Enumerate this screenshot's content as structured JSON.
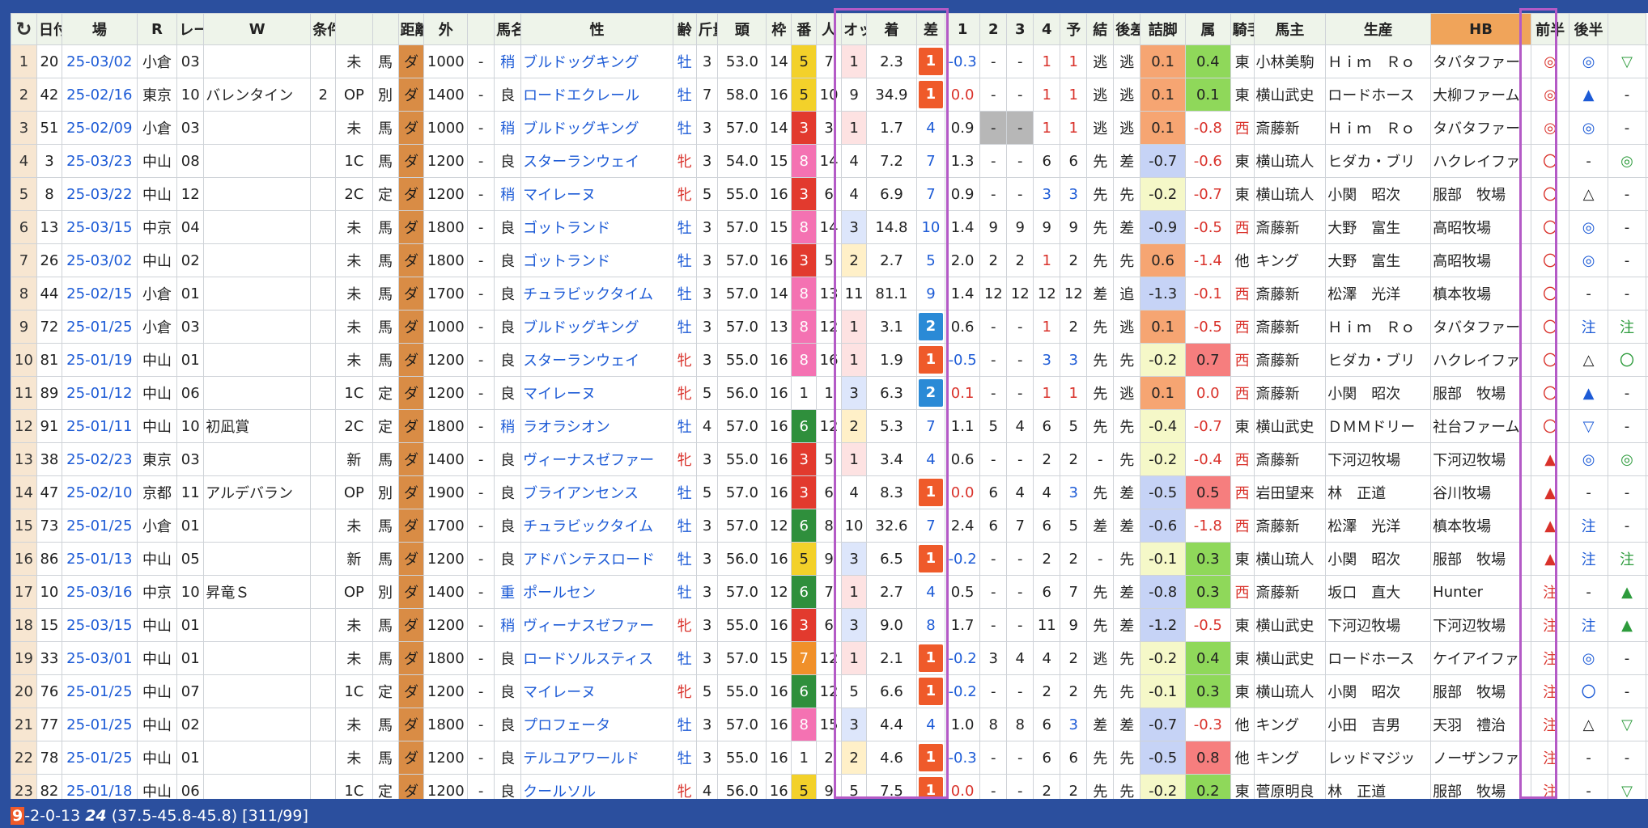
{
  "headers": [
    "↻",
    "日付",
    "場",
    "R",
    "レース名",
    "W",
    "条件",
    "",
    "",
    "距離",
    "外",
    "",
    "馬名",
    "性",
    "齢",
    "斤量",
    "頭",
    "枠",
    "番",
    "人",
    "オッズ",
    "着",
    "差",
    "1",
    "2",
    "3",
    "4",
    "予",
    "結",
    "後差",
    "詰脚",
    "属",
    "騎手",
    "馬主",
    "生産",
    "HB",
    "前半",
    "後半",
    ""
  ],
  "rows": [
    [
      "1",
      "20",
      "25-03/02",
      "小倉",
      "03",
      "",
      "",
      "未",
      "馬",
      "ダ",
      "1000",
      "-",
      "稍",
      "ブルドッグキング",
      "牡",
      "3",
      "53.0",
      "14",
      "5",
      "7",
      "1",
      "2.3",
      "1",
      "-0.3",
      "-",
      "-",
      "1",
      "1",
      "逃",
      "逃",
      "0.1",
      "0.4",
      "東",
      "小林美駒",
      "Ｈｉｍ　Ｒｏ",
      "タバタファー",
      "◎",
      "◎",
      "▽"
    ],
    [
      "2",
      "42",
      "25-02/16",
      "東京",
      "10",
      "バレンタイン",
      "2",
      "OP",
      "別",
      "ダ",
      "1400",
      "-",
      "良",
      "ロードエクレール",
      "牡",
      "7",
      "58.0",
      "16",
      "5",
      "10",
      "9",
      "34.9",
      "1",
      "0.0",
      "-",
      "-",
      "1",
      "1",
      "逃",
      "逃",
      "0.1",
      "0.1",
      "東",
      "横山武史",
      "ロードホース",
      "大柳ファーム",
      "◎",
      "▲",
      "-"
    ],
    [
      "3",
      "51",
      "25-02/09",
      "小倉",
      "03",
      "",
      "",
      "未",
      "馬",
      "ダ",
      "1000",
      "-",
      "稍",
      "ブルドッグキング",
      "牡",
      "3",
      "57.0",
      "14",
      "3",
      "3",
      "1",
      "1.7",
      "4",
      "0.9",
      "-",
      "-",
      "1",
      "1",
      "逃",
      "逃",
      "0.1",
      "-0.8",
      "西",
      "斎藤新",
      "Ｈｉｍ　Ｒｏ",
      "タバタファー",
      "◎",
      "◎",
      "-"
    ],
    [
      "4",
      "3",
      "25-03/23",
      "中山",
      "08",
      "",
      "",
      "1C",
      "馬",
      "ダ",
      "1200",
      "-",
      "良",
      "スターランウェイ",
      "牝",
      "3",
      "54.0",
      "15",
      "8",
      "14",
      "4",
      "7.2",
      "7",
      "1.3",
      "-",
      "-",
      "6",
      "6",
      "先",
      "差",
      "-0.7",
      "-0.6",
      "東",
      "横山琉人",
      "ヒダカ・ブリ",
      "ハクレイファ",
      "〇",
      "-",
      "◎"
    ],
    [
      "5",
      "8",
      "25-03/22",
      "中山",
      "12",
      "",
      "",
      "2C",
      "定",
      "ダ",
      "1200",
      "-",
      "稍",
      "マイレーヌ",
      "牝",
      "5",
      "55.0",
      "16",
      "3",
      "6",
      "4",
      "6.9",
      "7",
      "0.9",
      "-",
      "-",
      "3",
      "3",
      "先",
      "先",
      "-0.2",
      "-0.7",
      "東",
      "横山琉人",
      "小関　昭次",
      "服部　牧場",
      "〇",
      "△",
      "-"
    ],
    [
      "6",
      "13",
      "25-03/15",
      "中京",
      "04",
      "",
      "",
      "未",
      "馬",
      "ダ",
      "1800",
      "-",
      "良",
      "ゴットランド",
      "牡",
      "3",
      "57.0",
      "15",
      "8",
      "14",
      "3",
      "14.8",
      "10",
      "1.4",
      "9",
      "9",
      "9",
      "9",
      "先",
      "差",
      "-0.9",
      "-0.5",
      "西",
      "斎藤新",
      "大野　富生",
      "高昭牧場",
      "〇",
      "◎",
      "-"
    ],
    [
      "7",
      "26",
      "25-03/02",
      "中山",
      "02",
      "",
      "",
      "未",
      "馬",
      "ダ",
      "1800",
      "-",
      "良",
      "ゴットランド",
      "牡",
      "3",
      "57.0",
      "16",
      "3",
      "5",
      "2",
      "2.7",
      "5",
      "2.0",
      "2",
      "2",
      "1",
      "2",
      "先",
      "先",
      "0.6",
      "-1.4",
      "他",
      "キング",
      "大野　富生",
      "高昭牧場",
      "〇",
      "◎",
      "-"
    ],
    [
      "8",
      "44",
      "25-02/15",
      "小倉",
      "01",
      "",
      "",
      "未",
      "馬",
      "ダ",
      "1700",
      "-",
      "良",
      "チュラビックタイム",
      "牡",
      "3",
      "57.0",
      "14",
      "8",
      "13",
      "11",
      "81.1",
      "9",
      "1.4",
      "12",
      "12",
      "12",
      "12",
      "差",
      "追",
      "-1.3",
      "-0.1",
      "西",
      "斎藤新",
      "松澤　光洋",
      "槙本牧場",
      "〇",
      "-",
      "-"
    ],
    [
      "9",
      "72",
      "25-01/25",
      "小倉",
      "03",
      "",
      "",
      "未",
      "馬",
      "ダ",
      "1000",
      "-",
      "良",
      "ブルドッグキング",
      "牡",
      "3",
      "57.0",
      "13",
      "8",
      "12",
      "1",
      "3.1",
      "2",
      "0.6",
      "-",
      "-",
      "1",
      "2",
      "先",
      "逃",
      "0.1",
      "-0.5",
      "西",
      "斎藤新",
      "Ｈｉｍ　Ｒｏ",
      "タバタファー",
      "〇",
      "注",
      "注"
    ],
    [
      "10",
      "81",
      "25-01/19",
      "中山",
      "01",
      "",
      "",
      "未",
      "馬",
      "ダ",
      "1200",
      "-",
      "良",
      "スターランウェイ",
      "牝",
      "3",
      "55.0",
      "16",
      "8",
      "16",
      "1",
      "1.9",
      "1",
      "-0.5",
      "-",
      "-",
      "3",
      "3",
      "先",
      "先",
      "-0.2",
      "0.7",
      "西",
      "斎藤新",
      "ヒダカ・ブリ",
      "ハクレイファ",
      "〇",
      "△",
      "〇"
    ],
    [
      "11",
      "89",
      "25-01/12",
      "中山",
      "06",
      "",
      "",
      "1C",
      "定",
      "ダ",
      "1200",
      "-",
      "良",
      "マイレーヌ",
      "牝",
      "5",
      "56.0",
      "16",
      "1",
      "1",
      "3",
      "6.3",
      "2",
      "0.1",
      "-",
      "-",
      "1",
      "1",
      "先",
      "逃",
      "0.1",
      "0.0",
      "西",
      "斎藤新",
      "小関　昭次",
      "服部　牧場",
      "〇",
      "▲",
      "-"
    ],
    [
      "12",
      "91",
      "25-01/11",
      "中山",
      "10",
      "初凪賞",
      "",
      "2C",
      "定",
      "ダ",
      "1800",
      "-",
      "稍",
      "ラオラシオン",
      "牡",
      "4",
      "57.0",
      "16",
      "6",
      "12",
      "2",
      "5.3",
      "7",
      "1.1",
      "5",
      "4",
      "6",
      "5",
      "先",
      "先",
      "-0.4",
      "-0.7",
      "東",
      "横山武史",
      "ＤＭＭドリー",
      "社台ファーム",
      "〇",
      "▽",
      "-"
    ],
    [
      "13",
      "38",
      "25-02/23",
      "東京",
      "03",
      "",
      "",
      "新",
      "馬",
      "ダ",
      "1400",
      "-",
      "良",
      "ヴィーナスゼファー",
      "牝",
      "3",
      "55.0",
      "16",
      "3",
      "5",
      "1",
      "3.4",
      "4",
      "0.6",
      "-",
      "-",
      "2",
      "2",
      "-",
      "先",
      "-0.2",
      "-0.4",
      "西",
      "斎藤新",
      "下河辺牧場",
      "下河辺牧場",
      "▲",
      "◎",
      "◎"
    ],
    [
      "14",
      "47",
      "25-02/10",
      "京都",
      "11",
      "アルデバラン",
      "",
      "OP",
      "別",
      "ダ",
      "1900",
      "-",
      "良",
      "ブライアンセンス",
      "牡",
      "5",
      "57.0",
      "16",
      "3",
      "6",
      "4",
      "8.3",
      "1",
      "0.0",
      "6",
      "4",
      "4",
      "3",
      "先",
      "差",
      "-0.5",
      "0.5",
      "西",
      "岩田望来",
      "林　正道",
      "谷川牧場",
      "▲",
      "-",
      "-"
    ],
    [
      "15",
      "73",
      "25-01/25",
      "小倉",
      "01",
      "",
      "",
      "未",
      "馬",
      "ダ",
      "1700",
      "-",
      "良",
      "チュラビックタイム",
      "牡",
      "3",
      "57.0",
      "12",
      "6",
      "8",
      "10",
      "32.6",
      "7",
      "2.4",
      "6",
      "7",
      "6",
      "5",
      "差",
      "差",
      "-0.6",
      "-1.8",
      "西",
      "斎藤新",
      "松澤　光洋",
      "槙本牧場",
      "▲",
      "注",
      "-"
    ],
    [
      "16",
      "86",
      "25-01/13",
      "中山",
      "05",
      "",
      "",
      "新",
      "馬",
      "ダ",
      "1200",
      "-",
      "良",
      "アドバンテスロード",
      "牡",
      "3",
      "56.0",
      "16",
      "5",
      "9",
      "3",
      "6.5",
      "1",
      "-0.2",
      "-",
      "-",
      "2",
      "2",
      "-",
      "先",
      "-0.1",
      "0.3",
      "東",
      "横山琉人",
      "小関　昭次",
      "服部　牧場",
      "▲",
      "注",
      "注"
    ],
    [
      "17",
      "10",
      "25-03/16",
      "中京",
      "10",
      "昇竜Ｓ",
      "",
      "OP",
      "別",
      "ダ",
      "1400",
      "-",
      "重",
      "ポールセン",
      "牡",
      "3",
      "57.0",
      "12",
      "6",
      "7",
      "1",
      "2.7",
      "4",
      "0.5",
      "-",
      "-",
      "6",
      "7",
      "先",
      "差",
      "-0.8",
      "0.3",
      "西",
      "斎藤新",
      "坂口　直大",
      "Hunter",
      "注",
      "-",
      "▲"
    ],
    [
      "18",
      "15",
      "25-03/15",
      "中山",
      "01",
      "",
      "",
      "未",
      "馬",
      "ダ",
      "1200",
      "-",
      "稍",
      "ヴィーナスゼファー",
      "牝",
      "3",
      "55.0",
      "16",
      "3",
      "6",
      "3",
      "9.0",
      "8",
      "1.7",
      "-",
      "-",
      "11",
      "9",
      "先",
      "差",
      "-1.2",
      "-0.5",
      "東",
      "横山武史",
      "下河辺牧場",
      "下河辺牧場",
      "注",
      "注",
      "▲"
    ],
    [
      "19",
      "33",
      "25-03/01",
      "中山",
      "01",
      "",
      "",
      "未",
      "馬",
      "ダ",
      "1800",
      "-",
      "良",
      "ロードソルスティス",
      "牡",
      "3",
      "57.0",
      "15",
      "7",
      "12",
      "1",
      "2.1",
      "1",
      "-0.2",
      "3",
      "4",
      "4",
      "2",
      "逃",
      "先",
      "-0.2",
      "0.4",
      "東",
      "横山武史",
      "ロードホース",
      "ケイアイファ",
      "注",
      "◎",
      "-"
    ],
    [
      "20",
      "76",
      "25-01/25",
      "中山",
      "07",
      "",
      "",
      "1C",
      "定",
      "ダ",
      "1200",
      "-",
      "良",
      "マイレーヌ",
      "牝",
      "5",
      "55.0",
      "16",
      "6",
      "12",
      "5",
      "6.6",
      "1",
      "-0.2",
      "-",
      "-",
      "2",
      "2",
      "先",
      "先",
      "-0.1",
      "0.3",
      "東",
      "横山琉人",
      "小関　昭次",
      "服部　牧場",
      "注",
      "〇",
      "-"
    ],
    [
      "21",
      "77",
      "25-01/25",
      "中山",
      "02",
      "",
      "",
      "未",
      "馬",
      "ダ",
      "1800",
      "-",
      "良",
      "プロフェータ",
      "牡",
      "3",
      "57.0",
      "16",
      "8",
      "15",
      "3",
      "4.4",
      "4",
      "1.0",
      "8",
      "8",
      "6",
      "3",
      "差",
      "差",
      "-0.7",
      "-0.3",
      "他",
      "キング",
      "小田　吉男",
      "天羽　禮治",
      "注",
      "△",
      "▽"
    ],
    [
      "22",
      "78",
      "25-01/25",
      "中山",
      "01",
      "",
      "",
      "未",
      "馬",
      "ダ",
      "1200",
      "-",
      "良",
      "テルユアワールド",
      "牡",
      "3",
      "55.0",
      "16",
      "1",
      "2",
      "2",
      "4.6",
      "1",
      "-0.3",
      "-",
      "-",
      "6",
      "6",
      "先",
      "先",
      "-0.5",
      "0.8",
      "他",
      "キング",
      "レッドマジッ",
      "ノーザンファ",
      "注",
      "-",
      "-"
    ],
    [
      "23",
      "82",
      "25-01/18",
      "中山",
      "06",
      "",
      "",
      "1C",
      "定",
      "ダ",
      "1200",
      "-",
      "良",
      "クールソル",
      "牝",
      "4",
      "56.0",
      "16",
      "5",
      "9",
      "5",
      "7.5",
      "1",
      "0.0",
      "-",
      "-",
      "2",
      "2",
      "先",
      "先",
      "-0.2",
      "0.2",
      "東",
      "菅原明良",
      "林　正道",
      "服部　牧場",
      "注",
      "-",
      "▽"
    ]
  ],
  "status": {
    "badge": "9",
    "text": "-2-0-13 ",
    "bold": "24",
    "rest": " (37.5-45.8-45.8) [311/99]"
  }
}
